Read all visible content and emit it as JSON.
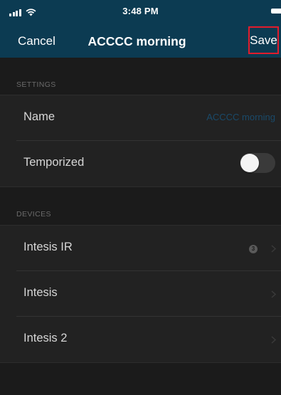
{
  "status_bar": {
    "time": "3:48 PM",
    "icons": [
      "signal-icon",
      "wifi-icon",
      "battery-icon"
    ]
  },
  "nav": {
    "cancel_label": "Cancel",
    "title": "ACCCC morning",
    "save_label": "Save"
  },
  "settings": {
    "header": "SETTINGS",
    "name_label": "Name",
    "name_value": "ACCCC morning",
    "temporized_label": "Temporized",
    "temporized_on": false
  },
  "devices": {
    "header": "DEVICES",
    "items": [
      {
        "label": "Intesis IR",
        "count": "3"
      },
      {
        "label": "Intesis"
      },
      {
        "label": "Intesis 2"
      }
    ]
  },
  "colors": {
    "nav_background": "#0c3b52",
    "page_background": "#1b1b1b",
    "save_highlight": "#e21c2c",
    "name_value_text": "#1a4a6a"
  }
}
